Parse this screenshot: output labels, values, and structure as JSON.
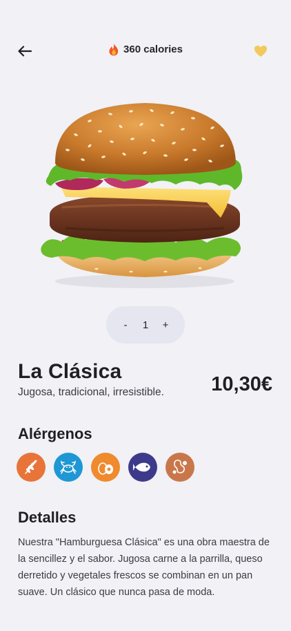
{
  "header": {
    "calories_label": "360 calories",
    "back_icon": "arrow-left-icon",
    "fire_icon": "fire-icon",
    "favorite_icon": "heart-icon"
  },
  "quantity": {
    "decrement_label": "-",
    "value": "1",
    "increment_label": "+"
  },
  "product": {
    "name": "La Clásica",
    "tagline": "Jugosa, tradicional, irresistible.",
    "price": "10,30€"
  },
  "allergens": {
    "title": "Alérgenos",
    "items": [
      {
        "icon": "wheat-icon",
        "color": "#e8743a"
      },
      {
        "icon": "crab-icon",
        "color": "#1f97d4"
      },
      {
        "icon": "egg-icon",
        "color": "#f08a2e"
      },
      {
        "icon": "fish-icon",
        "color": "#3d3a8c"
      },
      {
        "icon": "peanut-icon",
        "color": "#c9774a"
      }
    ]
  },
  "details": {
    "title": "Detalles",
    "text": "Nuestra \"Hamburguesa Clásica\" es una obra maestra de la sencillez y el sabor. Jugosa carne a la parrilla, queso derretido y vegetales frescos se combinan en un pan suave. Un clásico que nunca pasa de moda."
  },
  "colors": {
    "background": "#f1f1f6",
    "heart": "#f2c95c",
    "quantity_pill": "#e5e6ef"
  }
}
